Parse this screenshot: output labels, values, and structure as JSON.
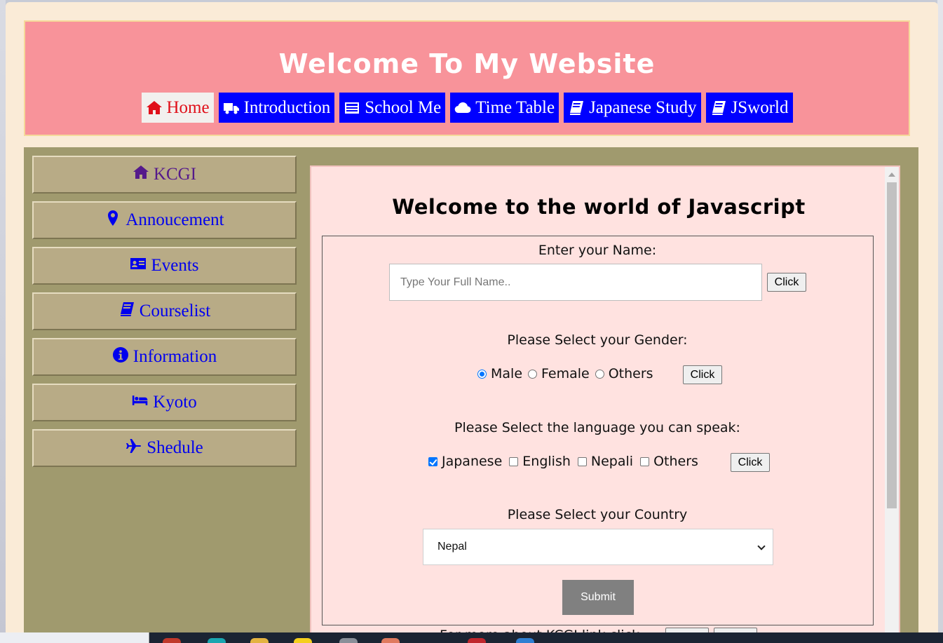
{
  "header": {
    "title": "Welcome To My Website",
    "nav": [
      {
        "label": "Home",
        "icon": "home-icon",
        "active": true
      },
      {
        "label": "Introduction",
        "icon": "truck-icon"
      },
      {
        "label": "School Me",
        "icon": "newspaper-icon"
      },
      {
        "label": "Time Table",
        "icon": "cloud-icon"
      },
      {
        "label": "Japanese Study",
        "icon": "book-icon"
      },
      {
        "label": "JSworld",
        "icon": "book-icon"
      }
    ]
  },
  "sidebar": {
    "items": [
      {
        "label": "KCGI",
        "icon": "home-icon"
      },
      {
        "label": "Annoucement",
        "icon": "map-marker-icon"
      },
      {
        "label": "Events",
        "icon": "id-card-icon"
      },
      {
        "label": "Courselist",
        "icon": "book-icon"
      },
      {
        "label": "Information",
        "icon": "info-circle-icon"
      },
      {
        "label": "Kyoto",
        "icon": "bed-icon"
      },
      {
        "label": "Shedule",
        "icon": "plane-icon"
      }
    ]
  },
  "main": {
    "title": "Welcome to the world of Javascript",
    "name_label": "Enter your Name:",
    "name_placeholder": "Type Your Full Name..",
    "name_value": "",
    "click_label": "Click",
    "gender_label": "Please Select your Gender:",
    "gender_options": [
      "Male",
      "Female",
      "Others"
    ],
    "gender_selected": "Male",
    "language_label": "Please Select the language you can speak:",
    "language_options": [
      "Japanese",
      "English",
      "Nepali",
      "Others"
    ],
    "language_checked": [
      "Japanese"
    ],
    "country_label": "Please Select your Country",
    "country_selected": "Nepal",
    "submit_label": "Submit",
    "cutoff_text": "For more about KCGI link click"
  },
  "colors": {
    "page_bg": "#faebd7",
    "header_bg": "#f8939a",
    "nav_bg": "#0000ff",
    "nav_active_bg": "#f2f0ee",
    "nav_active_text": "#e0101a",
    "content_bg": "#a09a6e",
    "sidebar_item_bg": "#b8ab86",
    "frame_bg": "#ffe2e0",
    "submit_bg": "#808080"
  }
}
